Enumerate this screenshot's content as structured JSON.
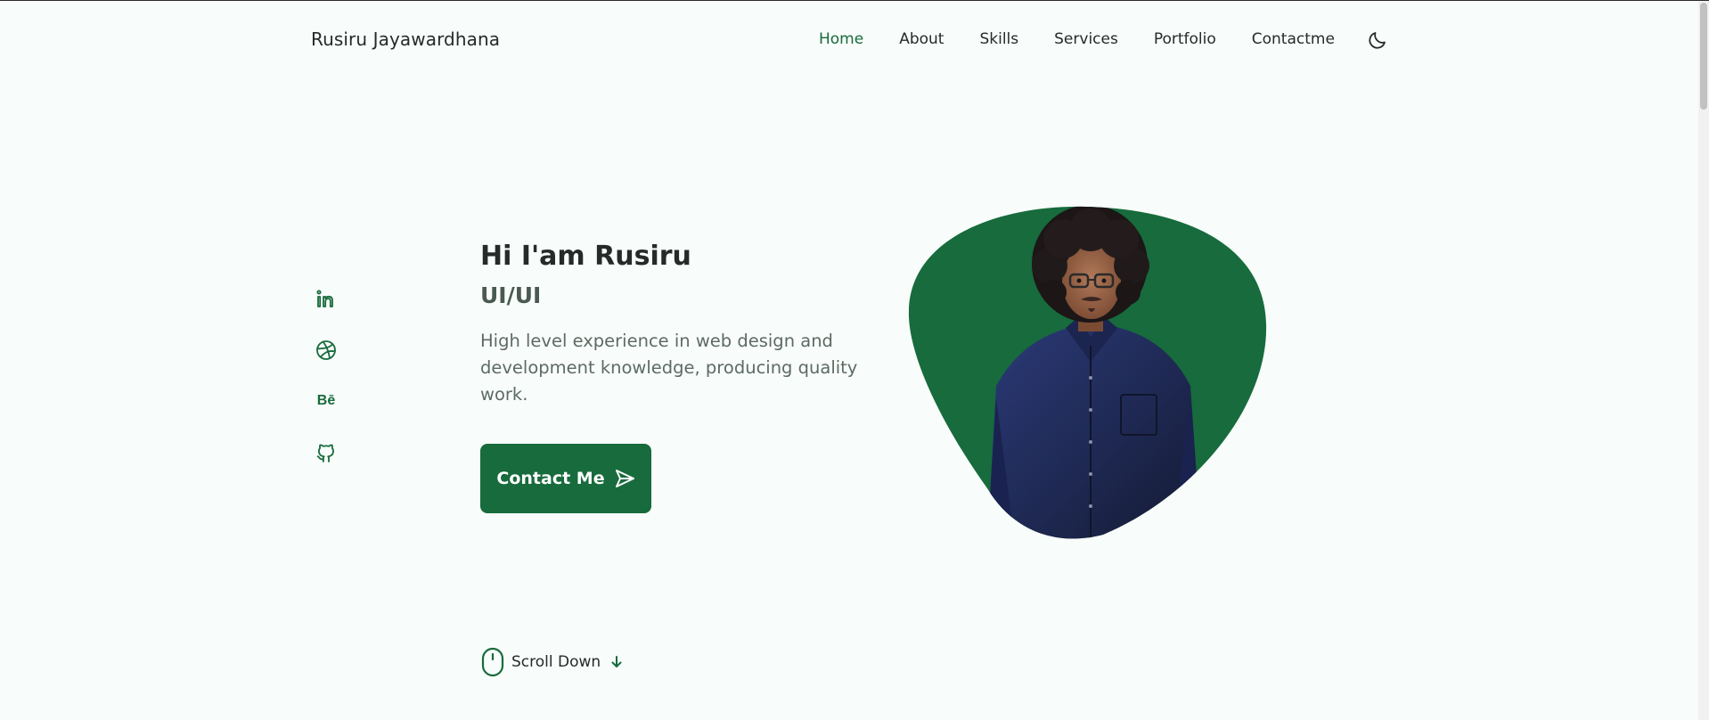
{
  "header": {
    "logo": "Rusiru Jayawardhana",
    "nav": [
      {
        "label": "Home",
        "active": true
      },
      {
        "label": "About",
        "active": false
      },
      {
        "label": "Skills",
        "active": false
      },
      {
        "label": "Services",
        "active": false
      },
      {
        "label": "Portfolio",
        "active": false
      },
      {
        "label": "Contactme",
        "active": false
      }
    ],
    "theme_icon": "moon-icon"
  },
  "socials": [
    {
      "name": "linkedin-icon"
    },
    {
      "name": "dribbble-icon"
    },
    {
      "name": "behance-icon",
      "text": "Bē"
    },
    {
      "name": "github-icon"
    }
  ],
  "hero": {
    "title": "Hi I'am Rusiru",
    "subtitle": "UI/UI",
    "description": "High level experience in web design and development knowledge, producing quality work.",
    "contact_button": "Contact Me",
    "contact_icon": "send-icon"
  },
  "scroll": {
    "label": "Scroll Down",
    "mouse_icon": "mouse-icon",
    "arrow_icon": "arrow-down-icon"
  },
  "colors": {
    "accent": "#176b3c",
    "background": "#f8fcfa",
    "title": "#262b29",
    "text": "#5c6b64"
  }
}
